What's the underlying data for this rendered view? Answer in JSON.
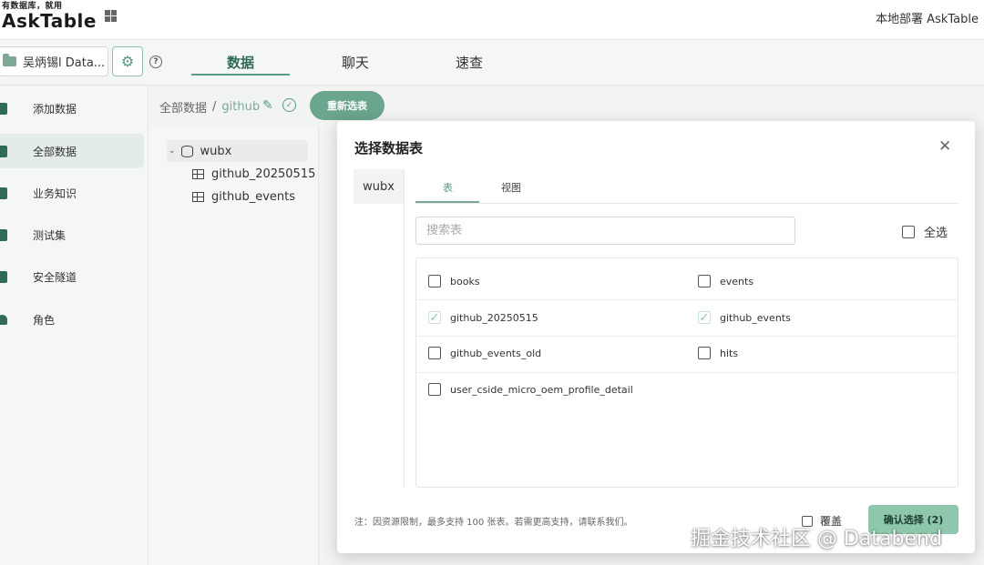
{
  "topbar": {
    "slogan": "有数据库，就用",
    "brand": "AskTable",
    "deploy_label": "本地部署 AskTable"
  },
  "subbar": {
    "datasource_label": "吴炳锡l Data...",
    "tabs": [
      {
        "label": "数据",
        "active": true
      },
      {
        "label": "聊天",
        "active": false
      },
      {
        "label": "速查",
        "active": false
      }
    ]
  },
  "sidebar": {
    "items": [
      {
        "label": "添加数据",
        "icon": "add-data-icon",
        "active": false
      },
      {
        "label": "全部数据",
        "icon": "database-icon",
        "active": true
      },
      {
        "label": "业务知识",
        "icon": "book-icon",
        "active": false
      },
      {
        "label": "测试集",
        "icon": "testset-icon",
        "active": false
      },
      {
        "label": "安全隧道",
        "icon": "shield-icon",
        "active": false
      },
      {
        "label": "角色",
        "icon": "user-icon",
        "active": false
      }
    ]
  },
  "breadcrumb": {
    "root": "全部数据",
    "separator": "/",
    "current": "github"
  },
  "reselect_button": "重新选表",
  "tree": {
    "root": "wubx",
    "children": [
      "github_20250515",
      "github_events"
    ]
  },
  "modal": {
    "title": "选择数据表",
    "schemas": [
      "wubx"
    ],
    "tabs": [
      {
        "label": "表",
        "active": true
      },
      {
        "label": "视图",
        "active": false
      }
    ],
    "search_placeholder": "搜索表",
    "search_value": "",
    "select_all_label": "全选",
    "tables": [
      {
        "name": "books",
        "checked": false
      },
      {
        "name": "events",
        "checked": false
      },
      {
        "name": "github_20250515",
        "checked": true
      },
      {
        "name": "github_events",
        "checked": true
      },
      {
        "name": "github_events_old",
        "checked": false
      },
      {
        "name": "hits",
        "checked": false
      },
      {
        "name": "user_cside_micro_oem_profile_detail",
        "checked": false
      }
    ],
    "note": "注：因资源限制，最多支持 100 张表。若需更高支持，请联系我们。",
    "cover_label": "覆盖",
    "confirm_label": "确认选择 (2)"
  },
  "watermark": "掘金技术社区 @ Databend",
  "colors": {
    "accent": "#5a9a82",
    "accent_light": "#8fc7ad",
    "button_green": "#6aa58d"
  }
}
